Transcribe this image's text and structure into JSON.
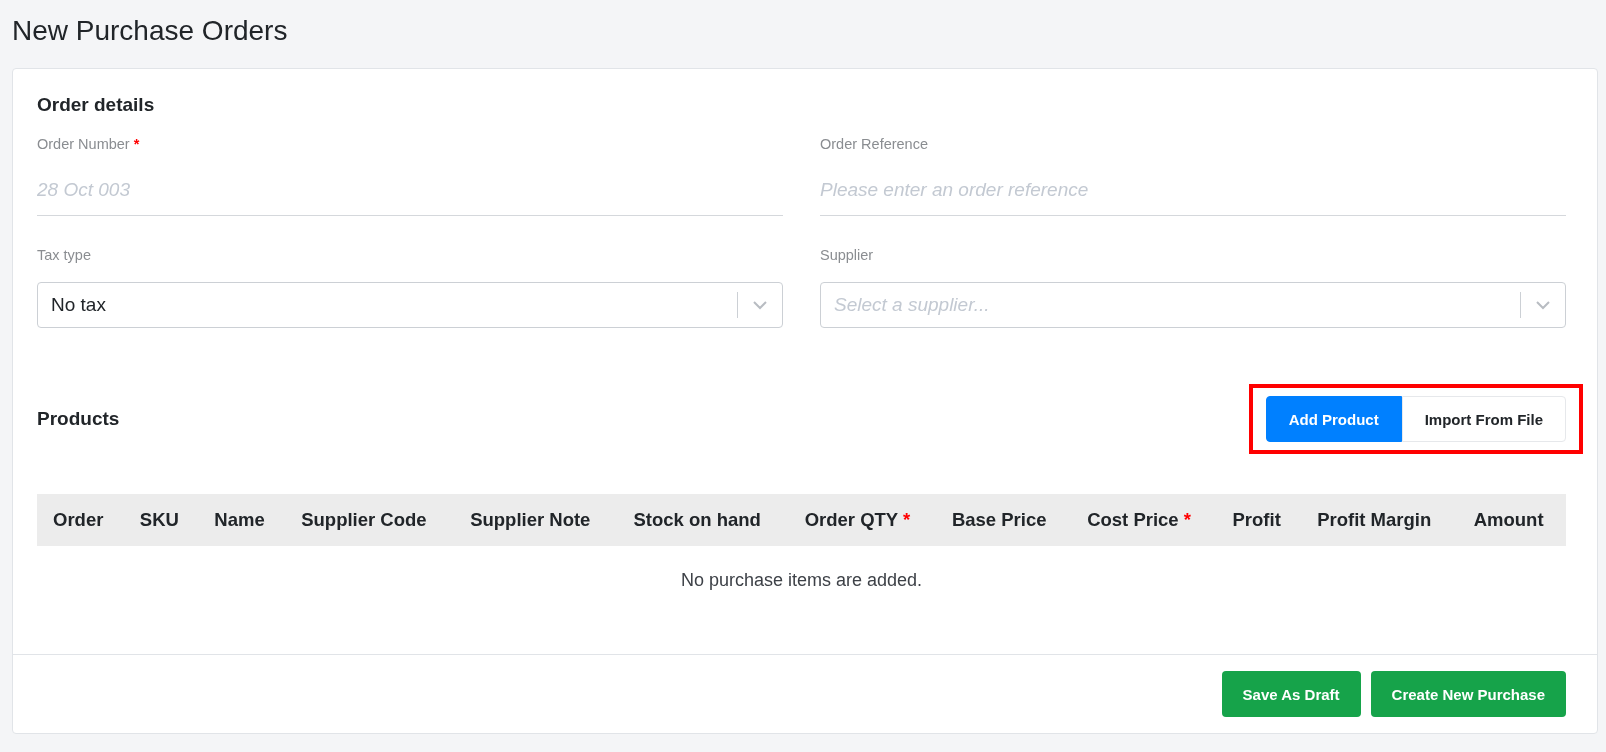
{
  "page_title": "New Purchase Orders",
  "order_details": {
    "title": "Order details",
    "fields": [
      {
        "kind": "text",
        "label": "Order Number",
        "required_mark": "*",
        "placeholder": "28 Oct 003"
      },
      {
        "kind": "text",
        "label": "Order Reference",
        "placeholder": "Please enter an order reference"
      },
      {
        "kind": "select",
        "label": "Tax type",
        "value": "No tax"
      },
      {
        "kind": "select",
        "label": "Supplier",
        "placeholder": "Select a supplier..."
      }
    ]
  },
  "products": {
    "title": "Products",
    "highlighted": true,
    "buttons": [
      {
        "label": "Add Product",
        "kind": "primary"
      },
      {
        "label": "Import From File",
        "kind": "secondary"
      }
    ],
    "columns": [
      {
        "label": "Order"
      },
      {
        "label": "SKU"
      },
      {
        "label": "Name"
      },
      {
        "label": "Supplier Code"
      },
      {
        "label": "Supplier Note"
      },
      {
        "label": "Stock on hand"
      },
      {
        "label": "Order QTY",
        "required_mark": "*"
      },
      {
        "label": "Base Price"
      },
      {
        "label": "Cost Price",
        "required_mark": "*"
      },
      {
        "label": "Profit"
      },
      {
        "label": "Profit Margin"
      },
      {
        "label": "Amount"
      }
    ],
    "empty_text": "No purchase items are added."
  },
  "footer_buttons": [
    "Save As Draft",
    "Create New Purchase"
  ]
}
